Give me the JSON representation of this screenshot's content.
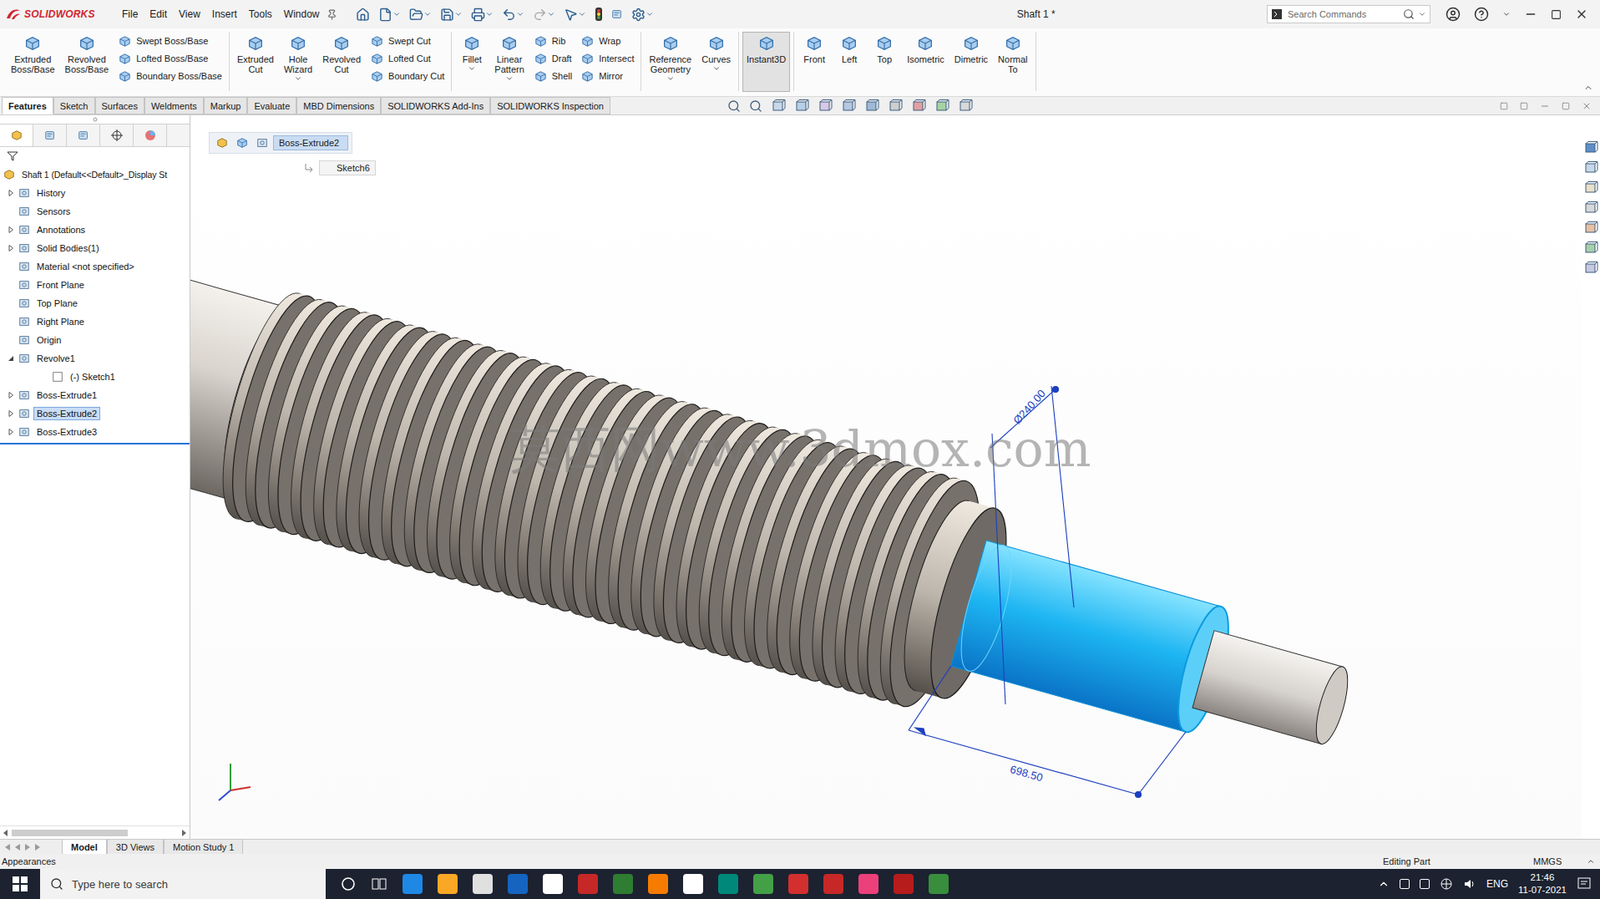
{
  "window": {
    "title": "Shaft 1 *",
    "logo": "SOLIDWORKS"
  },
  "menu": [
    "File",
    "Edit",
    "View",
    "Insert",
    "Tools",
    "Window"
  ],
  "search": {
    "placeholder": "Search Commands"
  },
  "ribbon": [
    [
      {
        "kind": "large",
        "lines": [
          "Extruded",
          "Boss/Base"
        ],
        "selected": false,
        "dropdown": false
      },
      {
        "kind": "large",
        "lines": [
          "Revolved",
          "Boss/Base"
        ],
        "selected": false,
        "dropdown": false
      },
      {
        "kind": "stack",
        "items": [
          "Swept Boss/Base",
          "Lofted Boss/Base",
          "Boundary Boss/Base"
        ],
        "dropdown": false
      }
    ],
    [
      {
        "kind": "large",
        "lines": [
          "Extruded",
          "Cut"
        ],
        "selected": false,
        "dropdown": false
      },
      {
        "kind": "large",
        "lines": [
          "Hole",
          "Wizard"
        ],
        "selected": false,
        "dropdown": true
      },
      {
        "kind": "large",
        "lines": [
          "Revolved",
          "Cut"
        ],
        "selected": false,
        "dropdown": false
      },
      {
        "kind": "stack",
        "items": [
          "Swept Cut",
          "Lofted Cut",
          "Boundary Cut"
        ],
        "dropdown": false
      }
    ],
    [
      {
        "kind": "large",
        "lines": [
          "Fillet"
        ],
        "selected": false,
        "dropdown": true
      },
      {
        "kind": "large",
        "lines": [
          "Linear",
          "Pattern"
        ],
        "selected": false,
        "dropdown": true
      },
      {
        "kind": "stack",
        "items": [
          "Rib",
          "Draft",
          "Shell"
        ],
        "dropdown": false
      },
      {
        "kind": "stack",
        "items": [
          "Wrap",
          "Intersect",
          "Mirror"
        ],
        "dropdown": false
      }
    ],
    [
      {
        "kind": "large",
        "lines": [
          "Reference",
          "Geometry"
        ],
        "selected": false,
        "dropdown": true
      },
      {
        "kind": "large",
        "lines": [
          "Curves"
        ],
        "selected": false,
        "dropdown": true
      }
    ],
    [
      {
        "kind": "large",
        "lines": [
          "Instant3D"
        ],
        "selected": true,
        "dropdown": false
      }
    ],
    [
      {
        "kind": "large",
        "lines": [
          "Front"
        ],
        "selected": false,
        "dropdown": false
      },
      {
        "kind": "large",
        "lines": [
          "Left"
        ],
        "selected": false,
        "dropdown": false
      },
      {
        "kind": "large",
        "lines": [
          "Top"
        ],
        "selected": false,
        "dropdown": false
      },
      {
        "kind": "large",
        "lines": [
          "Isometric"
        ],
        "selected": false,
        "dropdown": false
      },
      {
        "kind": "large",
        "lines": [
          "Dimetric"
        ],
        "selected": false,
        "dropdown": false
      },
      {
        "kind": "large",
        "lines": [
          "Normal",
          "To"
        ],
        "selected": false,
        "dropdown": false
      }
    ]
  ],
  "tabs": [
    {
      "label": "Features",
      "selected": true
    },
    {
      "label": "Sketch",
      "selected": false
    },
    {
      "label": "Surfaces",
      "selected": false
    },
    {
      "label": "Weldments",
      "selected": false
    },
    {
      "label": "Markup",
      "selected": false
    },
    {
      "label": "Evaluate",
      "selected": false
    },
    {
      "label": "MBD Dimensions",
      "selected": false
    },
    {
      "label": "SOLIDWORKS Add-Ins",
      "selected": false
    },
    {
      "label": "SOLIDWORKS Inspection",
      "selected": false
    }
  ],
  "tree": {
    "items": [
      {
        "label": "Shaft 1  (Default<<Default>_Display St",
        "level": 0,
        "expandable": false,
        "expanded": false,
        "selected": false
      },
      {
        "label": "History",
        "level": 1,
        "expandable": true,
        "expanded": false,
        "selected": false
      },
      {
        "label": "Sensors",
        "level": 1,
        "expandable": false,
        "expanded": false,
        "selected": false
      },
      {
        "label": "Annotations",
        "level": 1,
        "expandable": true,
        "expanded": false,
        "selected": false
      },
      {
        "label": "Solid Bodies(1)",
        "level": 1,
        "expandable": true,
        "expanded": false,
        "selected": false
      },
      {
        "label": "Material <not specified>",
        "level": 1,
        "expandable": false,
        "expanded": false,
        "selected": false
      },
      {
        "label": "Front Plane",
        "level": 1,
        "expandable": false,
        "expanded": false,
        "selected": false
      },
      {
        "label": "Top Plane",
        "level": 1,
        "expandable": false,
        "expanded": false,
        "selected": false
      },
      {
        "label": "Right Plane",
        "level": 1,
        "expandable": false,
        "expanded": false,
        "selected": false
      },
      {
        "label": "Origin",
        "level": 1,
        "expandable": false,
        "expanded": false,
        "selected": false
      },
      {
        "label": "Revolve1",
        "level": 1,
        "expandable": true,
        "expanded": true,
        "selected": false
      },
      {
        "label": "(-) Sketch1",
        "level": 2,
        "expandable": false,
        "expanded": false,
        "selected": false
      },
      {
        "label": "Boss-Extrude1",
        "level": 1,
        "expandable": true,
        "expanded": false,
        "selected": false
      },
      {
        "label": "Boss-Extrude2",
        "level": 1,
        "expandable": true,
        "expanded": false,
        "selected": true
      },
      {
        "label": "Boss-Extrude3",
        "level": 1,
        "expandable": true,
        "expanded": false,
        "selected": false
      }
    ]
  },
  "breadcrumb": {
    "feature": "Boss-Extrude2",
    "sketch": "Sketch6"
  },
  "dimensions": {
    "diameter": "Ø240.00",
    "length": "698.50"
  },
  "watermark": "莫西网www.3dmox.com",
  "model_tabs": [
    {
      "label": "Model",
      "selected": true
    },
    {
      "label": "3D Views",
      "selected": false
    },
    {
      "label": "Motion Study 1",
      "selected": false
    }
  ],
  "status_bar": {
    "left": "Appearances",
    "mode": "Editing Part",
    "units": "MMGS"
  },
  "taskbar": {
    "search_placeholder": "Type here to search",
    "language": "ENG",
    "time": "21:46",
    "date": "11-07-2021"
  }
}
